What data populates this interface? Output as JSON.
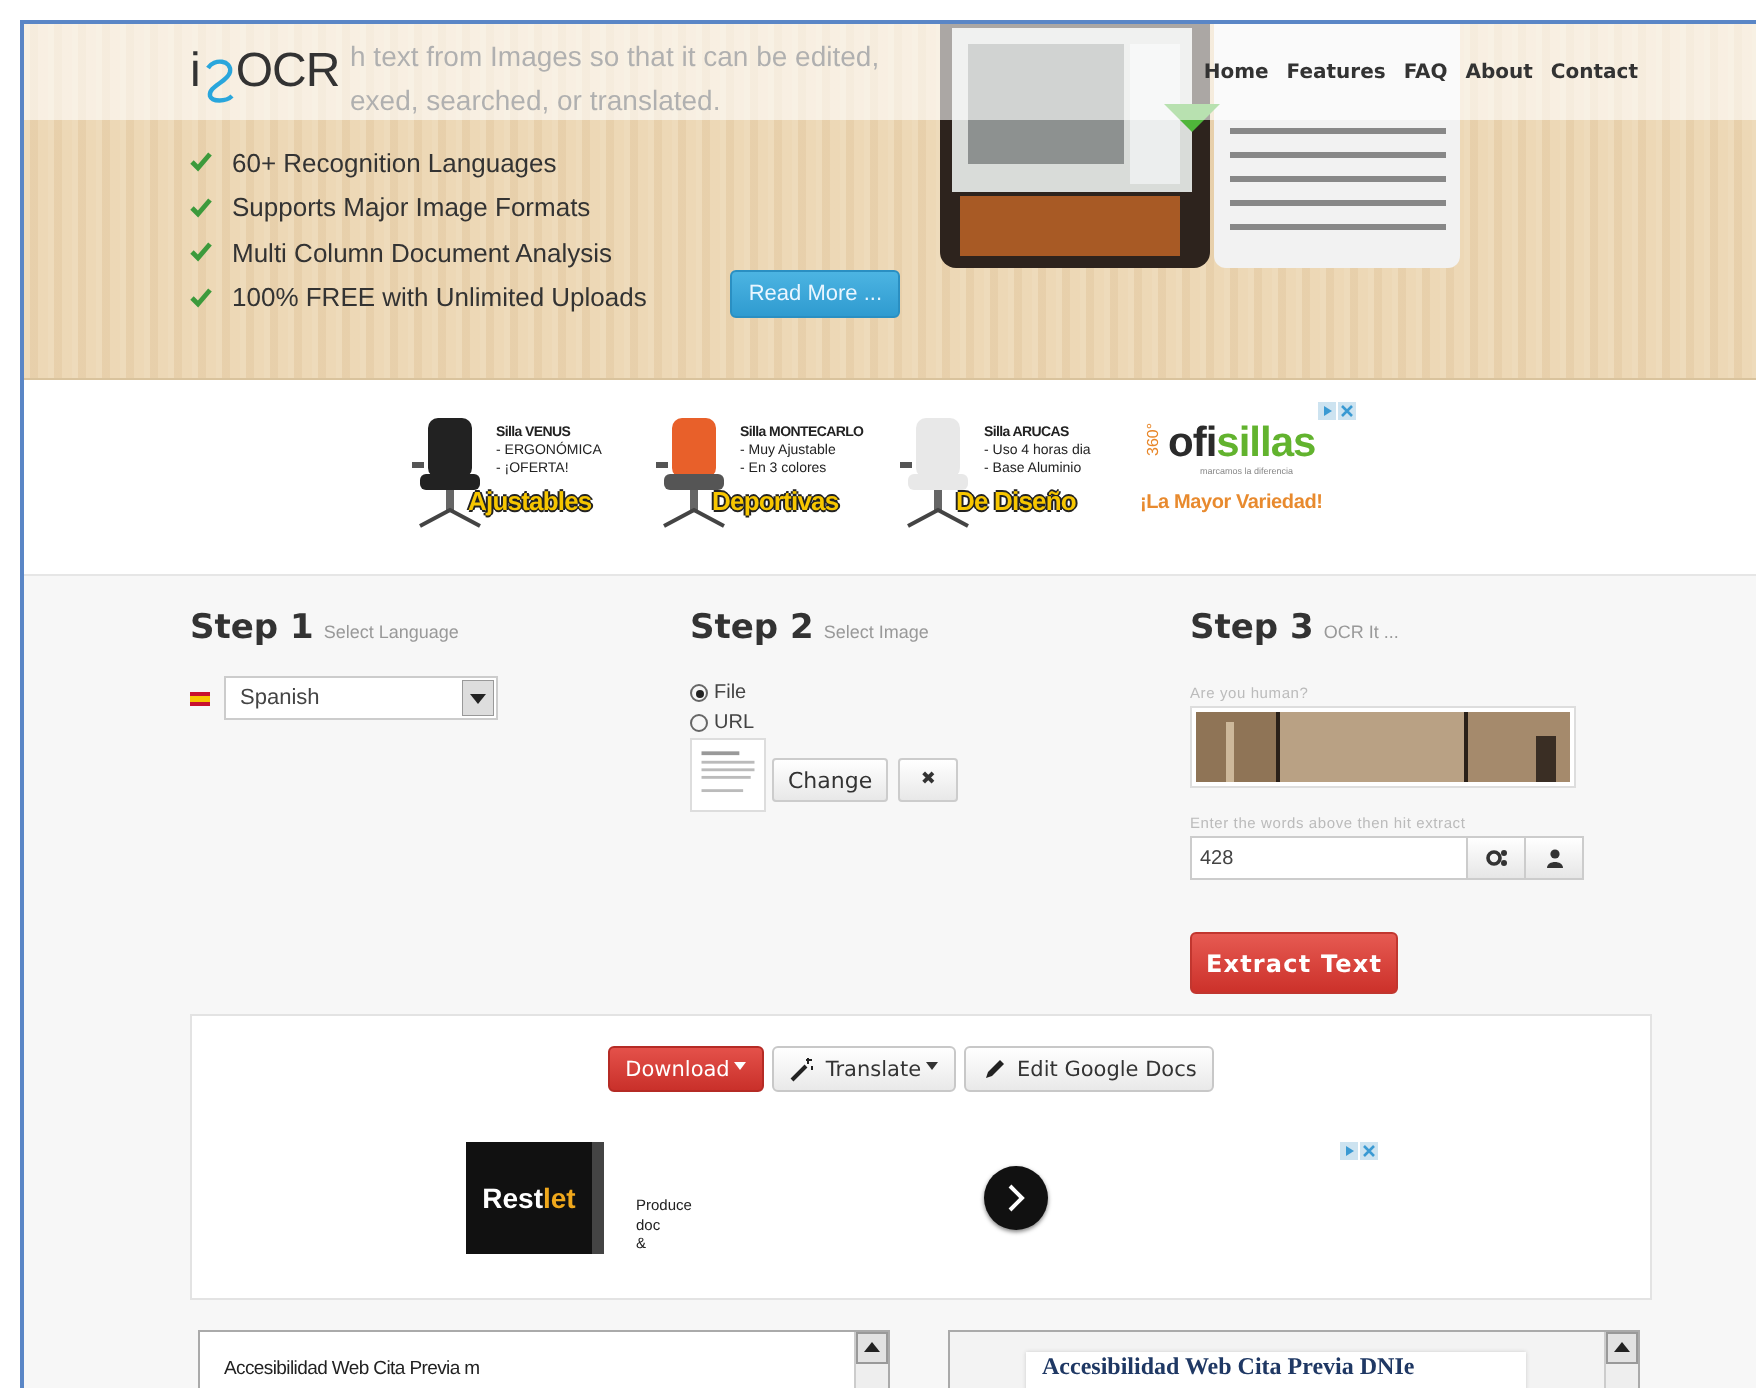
{
  "nav": {
    "logo": {
      "before": "i",
      "after": "OCR"
    },
    "links": [
      {
        "label": "Home"
      },
      {
        "label": "Features"
      },
      {
        "label": "FAQ"
      },
      {
        "label": "About"
      },
      {
        "label": "Contact"
      }
    ]
  },
  "hero": {
    "intro": [
      "h text from Images so that it can be edited,",
      "exed, searched, or translated."
    ],
    "features": [
      "60+ Recognition Languages",
      "Supports Major Image Formats",
      "Multi Column Document Analysis",
      "100% FREE with Unlimited Uploads"
    ],
    "read_more": "Read More ..."
  },
  "ad_banner": {
    "items": [
      {
        "title": "Silla VENUS",
        "lines": [
          "- ERGONÓMICA",
          "- ¡OFERTA!"
        ],
        "tag": "Ajustables"
      },
      {
        "title": "Silla MONTECARLO",
        "lines": [
          "- Muy Ajustable",
          "- En 3 colores"
        ],
        "tag": "Deportivas"
      },
      {
        "title": "Silla ARUCAS",
        "lines": [
          "- Uso 4 horas dia",
          "- Base Aluminio"
        ],
        "tag": "De Diseño"
      }
    ],
    "brand": {
      "badge": "360°",
      "name": [
        "ofi",
        "sillas"
      ],
      "motto": "marcamos la diferencia",
      "slogan": "¡La Mayor Variedad!"
    }
  },
  "steps": [
    {
      "kind": "language",
      "title": "Step 1",
      "hint": "Select Language",
      "value": "Spanish"
    },
    {
      "title": "Step 2",
      "hint": "Select Image",
      "sources": [
        {
          "label": "File",
          "selected": true
        },
        {
          "label": "URL",
          "selected": false
        }
      ],
      "change": "Change",
      "remove": "✖"
    },
    {
      "kind": "captcha",
      "title": "Step 3",
      "hint": "OCR It ...",
      "question": "Are you human?",
      "instruction": "Enter the words above then hit extract",
      "answer": "428",
      "submit": "Extract Text"
    }
  ],
  "results": {
    "buttons": [
      {
        "kind": "download",
        "label": "Download",
        "caret": true
      },
      {
        "kind": "translate",
        "label": "Translate",
        "caret": true
      },
      {
        "kind": "edit",
        "label": "Edit Google Docs",
        "caret": false
      }
    ],
    "ad": {
      "brand": [
        "Rest",
        "let"
      ],
      "lines": [
        "Produce",
        "doc",
        "&"
      ]
    }
  },
  "panels": {
    "plain_text": "Accesibilidad Web Cita Previa m",
    "formatted_text": "Accesibilidad Web Cita Previa DNIe"
  }
}
